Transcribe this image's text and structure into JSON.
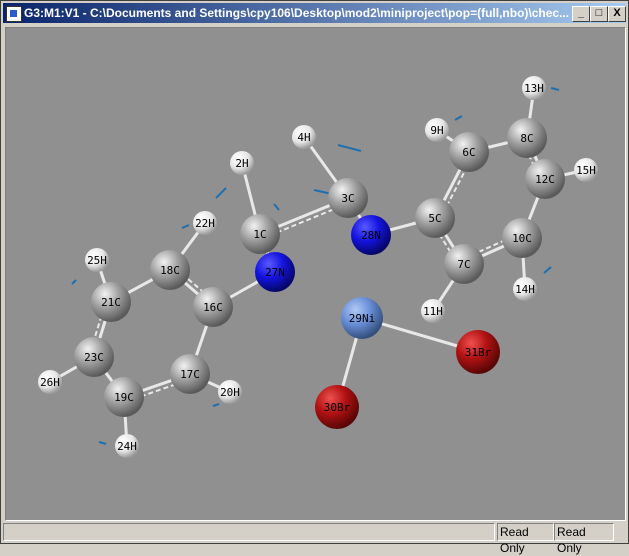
{
  "window": {
    "title": "G3:M1:V1 - C:\\Documents and Settings\\cpy106\\Desktop\\mod2\\miniproject\\pop=(full,nbo)\\chec...",
    "minimize": "_",
    "maximize": "□",
    "close": "X"
  },
  "status": {
    "main": "",
    "cell1": "Read Only",
    "cell2": "Read Only"
  },
  "colors": {
    "C": "#9a9a9a",
    "H": "#f0f0f0",
    "N": "#1414e0",
    "Ni": "#6a8fd8",
    "Br": "#b01212",
    "background": "#909090",
    "vector": "#1e6fb0"
  },
  "molecule": {
    "atoms": [
      {
        "label": "1C",
        "el": "C"
      },
      {
        "label": "2H",
        "el": "H"
      },
      {
        "label": "3C",
        "el": "C"
      },
      {
        "label": "4H",
        "el": "H"
      },
      {
        "label": "5C",
        "el": "C"
      },
      {
        "label": "6C",
        "el": "C"
      },
      {
        "label": "7C",
        "el": "C"
      },
      {
        "label": "8C",
        "el": "C"
      },
      {
        "label": "9H",
        "el": "H"
      },
      {
        "label": "10C",
        "el": "C"
      },
      {
        "label": "11H",
        "el": "H"
      },
      {
        "label": "12C",
        "el": "C"
      },
      {
        "label": "13H",
        "el": "H"
      },
      {
        "label": "14H",
        "el": "H"
      },
      {
        "label": "15H",
        "el": "H"
      },
      {
        "label": "16C",
        "el": "C"
      },
      {
        "label": "17C",
        "el": "C"
      },
      {
        "label": "18C",
        "el": "C"
      },
      {
        "label": "19C",
        "el": "C"
      },
      {
        "label": "20H",
        "el": "H"
      },
      {
        "label": "21C",
        "el": "C"
      },
      {
        "label": "22H",
        "el": "H"
      },
      {
        "label": "23C",
        "el": "C"
      },
      {
        "label": "24H",
        "el": "H"
      },
      {
        "label": "25H",
        "el": "H"
      },
      {
        "label": "26H",
        "el": "H"
      },
      {
        "label": "27N",
        "el": "N"
      },
      {
        "label": "28N",
        "el": "N"
      },
      {
        "label": "29Ni",
        "el": "Ni"
      },
      {
        "label": "30Br",
        "el": "Br"
      },
      {
        "label": "31Br",
        "el": "Br"
      }
    ],
    "bonds": [
      [
        1,
        2,
        0
      ],
      [
        1,
        3,
        1
      ],
      [
        1,
        27,
        0
      ],
      [
        3,
        4,
        0
      ],
      [
        3,
        28,
        0
      ],
      [
        28,
        5,
        0
      ],
      [
        5,
        6,
        1
      ],
      [
        5,
        7,
        1
      ],
      [
        6,
        9,
        0
      ],
      [
        6,
        8,
        0
      ],
      [
        8,
        13,
        0
      ],
      [
        8,
        12,
        1
      ],
      [
        12,
        15,
        0
      ],
      [
        12,
        10,
        0
      ],
      [
        10,
        14,
        0
      ],
      [
        10,
        7,
        1
      ],
      [
        7,
        11,
        0
      ],
      [
        27,
        16,
        0
      ],
      [
        16,
        18,
        1
      ],
      [
        16,
        17,
        0
      ],
      [
        18,
        22,
        0
      ],
      [
        18,
        21,
        0
      ],
      [
        21,
        25,
        0
      ],
      [
        21,
        23,
        1
      ],
      [
        23,
        26,
        0
      ],
      [
        23,
        19,
        0
      ],
      [
        19,
        24,
        0
      ],
      [
        19,
        17,
        1
      ],
      [
        17,
        20,
        0
      ],
      [
        29,
        31,
        0
      ],
      [
        29,
        30,
        0
      ]
    ]
  }
}
